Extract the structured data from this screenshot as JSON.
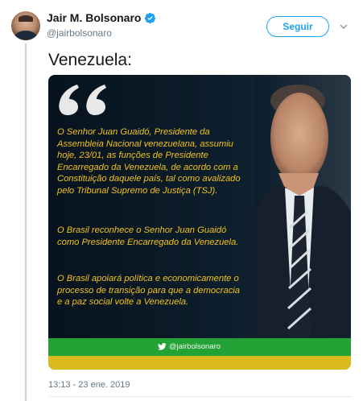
{
  "author": {
    "display_name": "Jair M. Bolsonaro",
    "handle": "@jairbolsonaro",
    "verified": true
  },
  "actions": {
    "follow_label": "Seguir"
  },
  "tweet": {
    "text": "Venezuela:",
    "timestamp": "13:13 - 23 ene. 2019"
  },
  "media": {
    "quote_paragraphs": [
      "O Senhor Juan Guaidó, Presidente da Assembleia Nacional venezuelana, assumiu hoje, 23/01, as funções de Presidente Encarregado da Venezuela, de acordo com a Constituição daquele país, tal como avalizado pelo Tribunal Supremo de Justiça (TSJ).",
      "O Brasil reconhece o Senhor Juan Guaidó como Presidente Encarregado da Venezuela.",
      "O Brasil apoiará política e economicamente o processo de transição para que a democracia e a paz social volte a Venezuela."
    ],
    "footer_handle": "@jairbolsonaro",
    "colors": {
      "quote_text": "#f3c21b",
      "footer_green": "#23a336",
      "footer_yellow": "#d9bb1e",
      "background": "#0c1d2b"
    }
  },
  "theme": {
    "accent": "#1da1f2",
    "secondary_text": "#657786"
  }
}
